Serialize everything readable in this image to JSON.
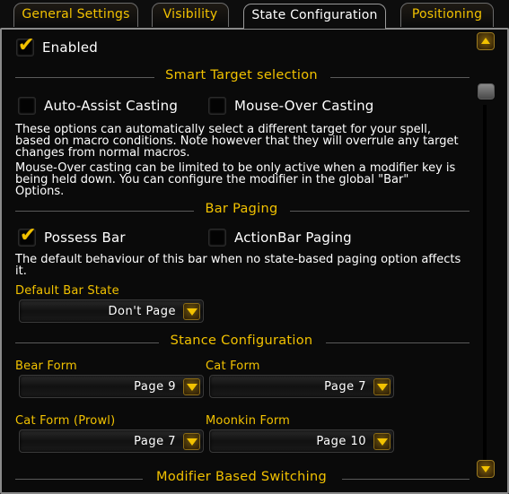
{
  "tabs": [
    {
      "label": "General Settings"
    },
    {
      "label": "Visibility"
    },
    {
      "label": "State Configuration",
      "active": true
    },
    {
      "label": "Positioning"
    }
  ],
  "enabled": {
    "label": "Enabled",
    "checked": true
  },
  "smart_target": {
    "title": "Smart Target selection",
    "auto_assist": {
      "label": "Auto-Assist Casting",
      "checked": false
    },
    "mouse_over": {
      "label": "Mouse-Over Casting",
      "checked": false
    },
    "desc1_lines": [
      "These options can automatically select a different target for your spell,",
      "based on macro conditions. Note however that they will overrule any target",
      "changes from normal macros."
    ],
    "desc2_lines": [
      "Mouse-Over casting can be limited to be only active when a modifier key is",
      "being held down. You can configure the modifier in the global \"Bar\"",
      "Options."
    ]
  },
  "bar_paging": {
    "title": "Bar Paging",
    "possess": {
      "label": "Possess Bar",
      "checked": true
    },
    "actionbar": {
      "label": "ActionBar Paging",
      "checked": false
    },
    "desc_lines": [
      "The default behaviour of this bar when no state-based paging option affects",
      "it."
    ],
    "default_state_label": "Default Bar State",
    "default_state_value": "Don't Page"
  },
  "stance": {
    "title": "Stance Configuration",
    "bear": {
      "label": "Bear Form",
      "value": "Page 9"
    },
    "cat": {
      "label": "Cat Form",
      "value": "Page 7"
    },
    "prowl": {
      "label": "Cat Form (Prowl)",
      "value": "Page 7"
    },
    "moonkin": {
      "label": "Moonkin Form",
      "value": "Page 10"
    }
  },
  "modifier": {
    "title": "Modifier Based Switching"
  },
  "icons": {
    "check": "checkmark-icon",
    "dropdown": "chevron-down-icon",
    "scroll_up": "scroll-up-arrow-icon",
    "scroll_down": "scroll-down-arrow-icon"
  },
  "colors": {
    "accent": "#f2c200",
    "text": "#ffffff",
    "background": "#0a0a0a",
    "border": "#8a8a8a"
  }
}
